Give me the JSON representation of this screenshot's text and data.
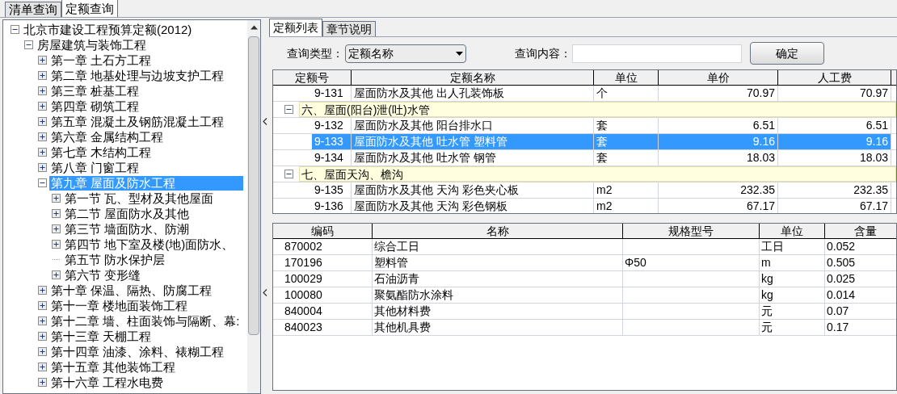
{
  "top_tabs": [
    {
      "label": "清单查询",
      "selected": false
    },
    {
      "label": "定额查询",
      "selected": true
    }
  ],
  "tree": [
    {
      "label": "北京市建设工程预算定额(2012)",
      "kind": "group",
      "expanded": true,
      "selected": false,
      "children": [
        {
          "label": "房屋建筑与装饰工程",
          "kind": "group",
          "expanded": true,
          "selected": false,
          "children": [
            {
              "label": "第一章  土石方工程",
              "kind": "group",
              "expanded": false,
              "selected": false
            },
            {
              "label": "第二章  地基处理与边坡支护工程",
              "kind": "group",
              "expanded": false,
              "selected": false
            },
            {
              "label": "第三章  桩基工程",
              "kind": "group",
              "expanded": false,
              "selected": false
            },
            {
              "label": "第四章  砌筑工程",
              "kind": "group",
              "expanded": false,
              "selected": false
            },
            {
              "label": "第五章  混凝土及钢筋混凝土工程",
              "kind": "group",
              "expanded": false,
              "selected": false
            },
            {
              "label": "第六章  金属结构工程",
              "kind": "group",
              "expanded": false,
              "selected": false
            },
            {
              "label": "第七章  木结构工程",
              "kind": "group",
              "expanded": false,
              "selected": false
            },
            {
              "label": "第八章  门窗工程",
              "kind": "group",
              "expanded": false,
              "selected": false
            },
            {
              "label": "第九章  屋面及防水工程",
              "kind": "group",
              "expanded": true,
              "selected": true,
              "children": [
                {
                  "label": "第一节  瓦、型材及其他屋面",
                  "kind": "group",
                  "expanded": false,
                  "selected": false
                },
                {
                  "label": "第二节  屋面防水及其他",
                  "kind": "group",
                  "expanded": false,
                  "selected": false
                },
                {
                  "label": "第三节  墙面防水、防潮",
                  "kind": "group",
                  "expanded": false,
                  "selected": false
                },
                {
                  "label": "第四节  地下室及楼(地)面防水、",
                  "kind": "group",
                  "expanded": false,
                  "selected": false
                },
                {
                  "label": "第五节  防水保护层",
                  "kind": "leaf",
                  "selected": false
                },
                {
                  "label": "第六节  变形缝",
                  "kind": "group",
                  "expanded": false,
                  "selected": false
                }
              ]
            },
            {
              "label": "第十章  保温、隔热、防腐工程",
              "kind": "group",
              "expanded": false,
              "selected": false
            },
            {
              "label": "第十一章  楼地面装饰工程",
              "kind": "group",
              "expanded": false,
              "selected": false
            },
            {
              "label": "第十二章  墙、柱面装饰与隔断、幕:",
              "kind": "group",
              "expanded": false,
              "selected": false
            },
            {
              "label": "第十三章  天棚工程",
              "kind": "group",
              "expanded": false,
              "selected": false
            },
            {
              "label": "第十四章  油漆、涂料、裱糊工程",
              "kind": "group",
              "expanded": false,
              "selected": false
            },
            {
              "label": "第十五章  其他装饰工程",
              "kind": "group",
              "expanded": false,
              "selected": false
            },
            {
              "label": "第十六章  工程水电费",
              "kind": "group",
              "expanded": false,
              "selected": false
            }
          ]
        }
      ]
    }
  ],
  "right_tabs": [
    {
      "label": "定额列表",
      "selected": true
    },
    {
      "label": "章节说明",
      "selected": false
    }
  ],
  "query": {
    "type_label": "查询类型：",
    "type_value": "定额名称",
    "content_label": "查询内容：",
    "button": "确定"
  },
  "quota_table": {
    "columns": [
      "定额号",
      "定额名称",
      "单位",
      "单价",
      "人工费"
    ],
    "rows": [
      {
        "kind": "item",
        "selected": false,
        "cells": [
          "9-131",
          "屋面防水及其他 出人孔装饰板",
          "个",
          "70.97",
          "70.97"
        ]
      },
      {
        "kind": "section",
        "selected": false,
        "cells": [
          "六、屋面(阳台)泄(吐)水管"
        ]
      },
      {
        "kind": "item",
        "selected": false,
        "cells": [
          "9-132",
          "屋面防水及其他 阳台排水口",
          "套",
          "6.51",
          "6.51"
        ]
      },
      {
        "kind": "item",
        "selected": true,
        "cells": [
          "9-133",
          "屋面防水及其他 吐水管 塑料管",
          "套",
          "9.16",
          "9.16"
        ]
      },
      {
        "kind": "item",
        "selected": false,
        "cells": [
          "9-134",
          "屋面防水及其他 吐水管 钢管",
          "套",
          "18.03",
          "18.03"
        ]
      },
      {
        "kind": "section",
        "selected": false,
        "cells": [
          "七、屋面天沟、檐沟"
        ]
      },
      {
        "kind": "item",
        "selected": false,
        "cells": [
          "9-135",
          "屋面防水及其他 天沟 彩色夹心板",
          "m2",
          "232.35",
          "232.35"
        ]
      },
      {
        "kind": "item",
        "selected": false,
        "cells": [
          "9-136",
          "屋面防水及其他 天沟 彩色钢板",
          "m2",
          "67.17",
          "67.17"
        ]
      }
    ]
  },
  "resource_table": {
    "columns": [
      "编码",
      "名称",
      "规格型号",
      "单位",
      "含量"
    ],
    "rows": [
      [
        "870002",
        "综合工日",
        "",
        "工日",
        "0.052"
      ],
      [
        "170196",
        "塑料管",
        "Φ50",
        "m",
        "0.505"
      ],
      [
        "100029",
        "石油沥青",
        "",
        "kg",
        "0.025"
      ],
      [
        "100080",
        "聚氨酯防水涂料",
        "",
        "kg",
        "0.014"
      ],
      [
        "840004",
        "其他材料费",
        "",
        "元",
        "0.07"
      ],
      [
        "840023",
        "其他机具费",
        "",
        "元",
        "0.17"
      ]
    ]
  }
}
